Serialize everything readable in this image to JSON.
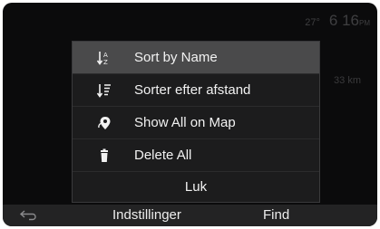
{
  "status": {
    "temperature": "27°",
    "time": "6 16",
    "ampm": "PM"
  },
  "background": {
    "distance": "33 km"
  },
  "menu": {
    "items": [
      {
        "label": "Sort by Name",
        "icon": "sort-alpha-icon",
        "selected": true
      },
      {
        "label": "Sorter efter afstand",
        "icon": "sort-distance-icon",
        "selected": false
      },
      {
        "label": "Show All on Map",
        "icon": "map-pin-icon",
        "selected": false
      },
      {
        "label": "Delete All",
        "icon": "trash-icon",
        "selected": false
      }
    ],
    "close_label": "Luk"
  },
  "bottombar": {
    "settings_label": "Indstillinger",
    "find_label": "Find"
  },
  "colors": {
    "background": "#0b0b0c",
    "menu": "#1c1c1d",
    "selected": "#4a4a4b",
    "text": "#f2f2f2"
  }
}
